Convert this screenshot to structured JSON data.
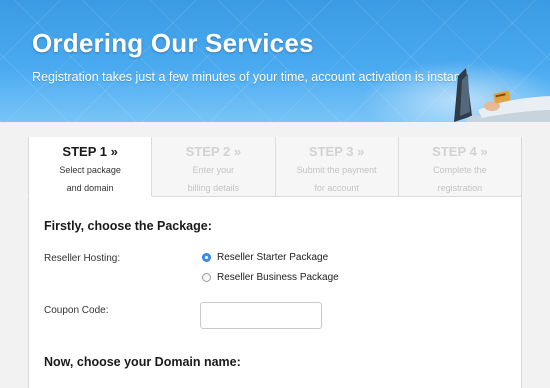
{
  "banner": {
    "title": "Ordering Our Services",
    "subtitle": "Registration takes just a few minutes of your time, account activation is instant.",
    "image_icon": "laptop-payment-photo",
    "colors": {
      "top": "#3a9be3",
      "bottom": "#79c4f7"
    }
  },
  "steps": [
    {
      "title": "STEP 1 »",
      "line1": "Select package",
      "line2": "and domain",
      "active": true
    },
    {
      "title": "STEP 2 »",
      "line1": "Enter your",
      "line2": "billing details",
      "active": false
    },
    {
      "title": "STEP 3 »",
      "line1": "Submit the payment",
      "line2": "for account",
      "active": false
    },
    {
      "title": "STEP 4 »",
      "line1": "Complete the",
      "line2": "registration",
      "active": false
    }
  ],
  "form": {
    "package_heading": "Firstly, choose the Package:",
    "reseller_label": "Reseller Hosting:",
    "options": [
      {
        "label": "Reseller Starter Package",
        "selected": true
      },
      {
        "label": "Reseller Business Package",
        "selected": false
      }
    ],
    "coupon_label": "Coupon Code:",
    "coupon_value": "",
    "coupon_placeholder": "",
    "domain_heading": "Now, choose your Domain name:"
  },
  "colors": {
    "accent": "#3b8ff0",
    "active_text": "#1a1a1a",
    "inactive_text": "#d2d2d2"
  }
}
